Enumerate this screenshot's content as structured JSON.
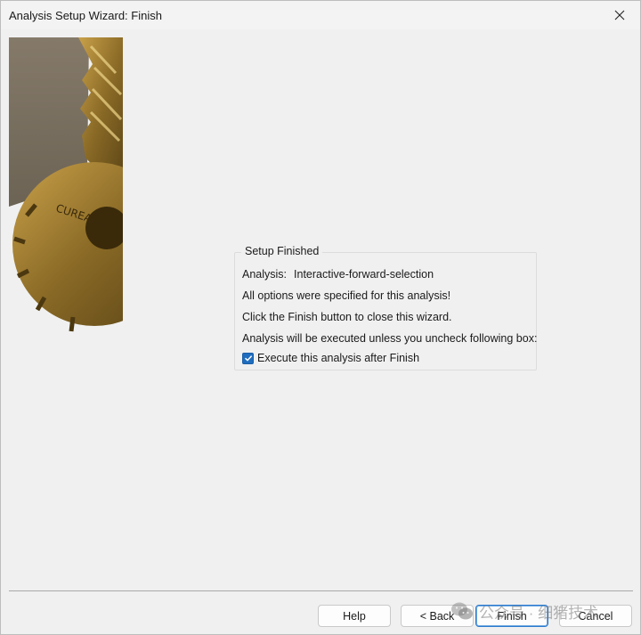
{
  "window": {
    "title": "Analysis Setup Wizard: Finish"
  },
  "group": {
    "legend": "Setup Finished",
    "analysis_label": "Analysis:",
    "analysis_name": "Interactive-forward-selection",
    "line2": "All options were specified for this analysis!",
    "line3": "Click the Finish button to close this wizard.",
    "line4": "Analysis will be executed unless you uncheck following box:",
    "checkbox_label": "Execute this analysis after Finish",
    "checkbox_checked": true
  },
  "buttons": {
    "help": "Help",
    "back": "< Back",
    "finish": "Finish",
    "cancel": "Cancel"
  },
  "watermark": {
    "text": "公众号 · 细猪技术"
  },
  "icons": {
    "close": "close-icon",
    "check": "checkmark-icon",
    "wizard_image": "key-image"
  },
  "colors": {
    "accent": "#1f6dbf",
    "background": "#f0f0f0"
  }
}
